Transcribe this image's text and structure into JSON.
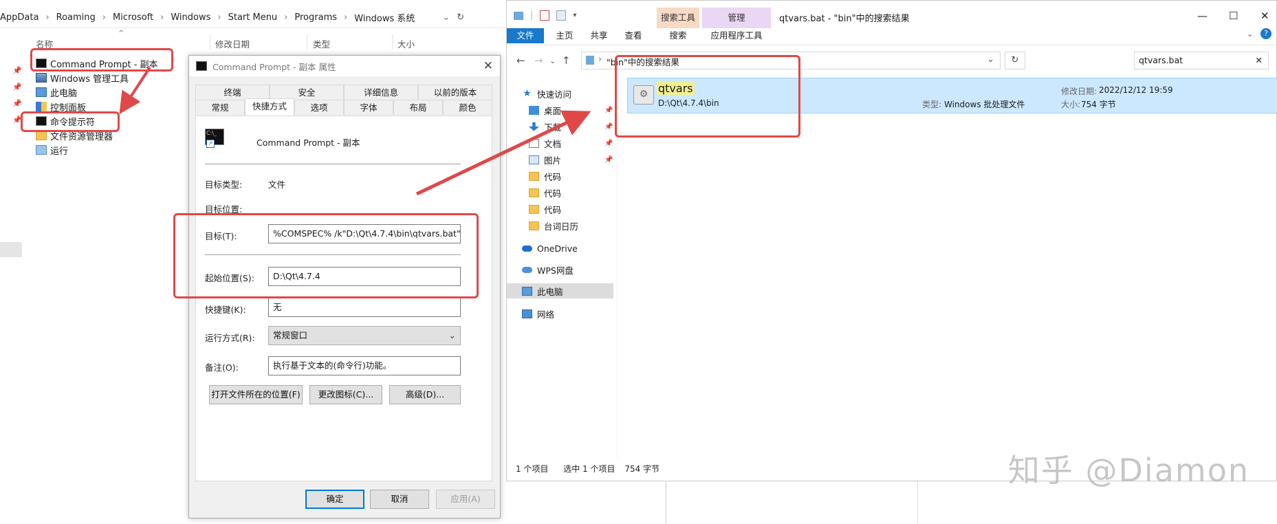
{
  "left_explorer": {
    "breadcrumb": [
      "AppData",
      "Roaming",
      "Microsoft",
      "Windows",
      "Start Menu",
      "Programs",
      "Windows 系统"
    ],
    "columns": {
      "name": "名称",
      "modified": "修改日期",
      "type": "类型",
      "size": "大小"
    },
    "items": [
      {
        "label": "Command Prompt - 副本",
        "icon": "cmd-icon"
      },
      {
        "label": "Windows 管理工具",
        "icon": "admin-tools-icon"
      },
      {
        "label": "此电脑",
        "icon": "computer-icon"
      },
      {
        "label": "控制面板",
        "icon": "control-panel-icon"
      },
      {
        "label": "命令提示符",
        "icon": "cmd-icon"
      },
      {
        "label": "文件资源管理器",
        "icon": "folder-icon"
      },
      {
        "label": "运行",
        "icon": "run-icon"
      }
    ]
  },
  "dialog": {
    "title": "Command Prompt - 副本 属性",
    "tabs_row1": [
      "终端",
      "安全",
      "详细信息",
      "以前的版本"
    ],
    "tabs_row2": [
      "常规",
      "快捷方式",
      "选项",
      "字体",
      "布局",
      "颜色"
    ],
    "active_tab": "快捷方式",
    "shortcut_name": "Command Prompt - 副本",
    "target_type_label": "目标类型:",
    "target_type_value": "文件",
    "target_location_label": "目标位置:",
    "target_label": "目标(T):",
    "target_value": "%COMSPEC% /k\"D:\\Qt\\4.7.4\\bin\\qtvars.bat\"",
    "start_in_label": "起始位置(S):",
    "start_in_value": "D:\\Qt\\4.7.4",
    "hotkey_label": "快捷键(K):",
    "hotkey_value": "无",
    "run_label": "运行方式(R):",
    "run_value": "常规窗口",
    "comment_label": "备注(O):",
    "comment_value": "执行基于文本的(命令行)功能。",
    "btn_open_location": "打开文件所在的位置(F)",
    "btn_change_icon": "更改图标(C)...",
    "btn_advanced": "高级(D)...",
    "btn_ok": "确定",
    "btn_cancel": "取消",
    "btn_apply": "应用(A)"
  },
  "right_explorer": {
    "window_title": "qtvars.bat - \"bin\"中的搜索结果",
    "context_groups": {
      "search_tools": "搜索工具",
      "manage": "管理"
    },
    "ribbon_tabs": [
      "文件",
      "主页",
      "共享",
      "查看",
      "搜索",
      "应用程序工具"
    ],
    "address_path": "\"bin\"中的搜索结果",
    "search_value": "qtvars.bat",
    "nav": [
      {
        "label": "快速访问",
        "icon": "star-icon"
      },
      {
        "label": "桌面",
        "icon": "desktop-icon"
      },
      {
        "label": "下载",
        "icon": "download-icon"
      },
      {
        "label": "文档",
        "icon": "document-icon"
      },
      {
        "label": "图片",
        "icon": "pictures-icon"
      },
      {
        "label": "代码",
        "icon": "folder-icon"
      },
      {
        "label": "代码",
        "icon": "folder-icon"
      },
      {
        "label": "代码",
        "icon": "folder-icon"
      },
      {
        "label": "台词日历",
        "icon": "folder-icon"
      },
      {
        "label": "OneDrive",
        "icon": "onedrive-icon"
      },
      {
        "label": "WPS网盘",
        "icon": "cloud-icon"
      },
      {
        "label": "此电脑",
        "icon": "computer-icon"
      },
      {
        "label": "网络",
        "icon": "network-icon"
      }
    ],
    "result": {
      "name": "qtvars",
      "path": "D:\\Qt\\4.7.4\\bin",
      "type_label": "类型:",
      "type_value": "Windows 批处理文件",
      "modified_label": "修改日期:",
      "modified_value": "2022/12/12 19:59",
      "size_label": "大小:",
      "size_value": "754 字节"
    },
    "status": {
      "count": "1 个项目",
      "selected": "选中 1 个项目",
      "size": "754 字节"
    }
  },
  "watermark": "知乎 @Diamon",
  "colors": {
    "annotation_red": "#e04848",
    "selection_blue": "#cce8ff",
    "file_tab_blue": "#1979ca",
    "search_tools_bg": "#f8d9c4",
    "manage_bg": "#ead6f5"
  }
}
